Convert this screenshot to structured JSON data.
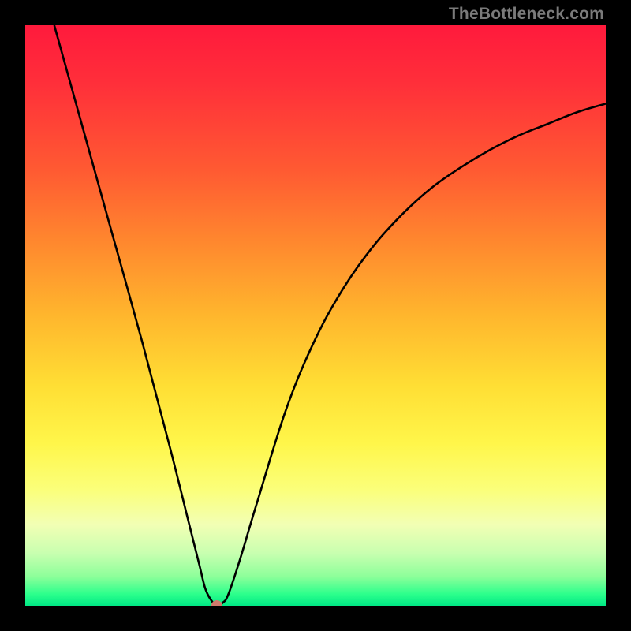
{
  "watermark": "TheBottleneck.com",
  "chart_data": {
    "type": "line",
    "title": "",
    "xlabel": "",
    "ylabel": "",
    "xlim": [
      0,
      100
    ],
    "ylim": [
      0,
      100
    ],
    "series": [
      {
        "name": "curve",
        "x": [
          5,
          10,
          15,
          20,
          25,
          28,
          30,
          31,
          32,
          33,
          34,
          35,
          37,
          40,
          45,
          50,
          55,
          60,
          65,
          70,
          75,
          80,
          85,
          90,
          95,
          100
        ],
        "y": [
          100,
          82,
          64,
          46,
          27,
          15,
          7,
          3,
          1,
          0,
          0.5,
          2,
          8,
          18,
          34,
          46,
          55,
          62,
          67.5,
          72,
          75.5,
          78.5,
          81,
          83,
          85,
          86.5
        ]
      }
    ],
    "marker": {
      "x": 33,
      "y": 0
    }
  },
  "colors": {
    "frame": "#000000",
    "curve": "#000000",
    "marker": "#cf7a6c",
    "watermark": "#7a7a7a"
  }
}
